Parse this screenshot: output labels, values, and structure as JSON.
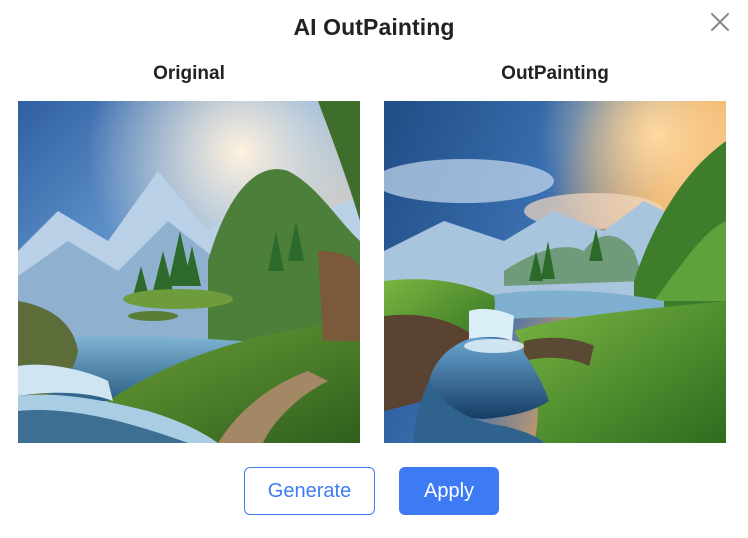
{
  "dialog": {
    "title": "AI OutPainting",
    "close_icon": "close-icon"
  },
  "panels": {
    "original_label": "Original",
    "outpainting_label": "OutPainting",
    "original_image": "fantasy-landscape-waterfall-original",
    "outpainting_image": "fantasy-landscape-waterfall-outpainted"
  },
  "actions": {
    "generate_label": "Generate",
    "apply_label": "Apply"
  },
  "colors": {
    "accent": "#3d7bf4",
    "title_text": "#222222",
    "close_icon": "#8a8a8a"
  }
}
